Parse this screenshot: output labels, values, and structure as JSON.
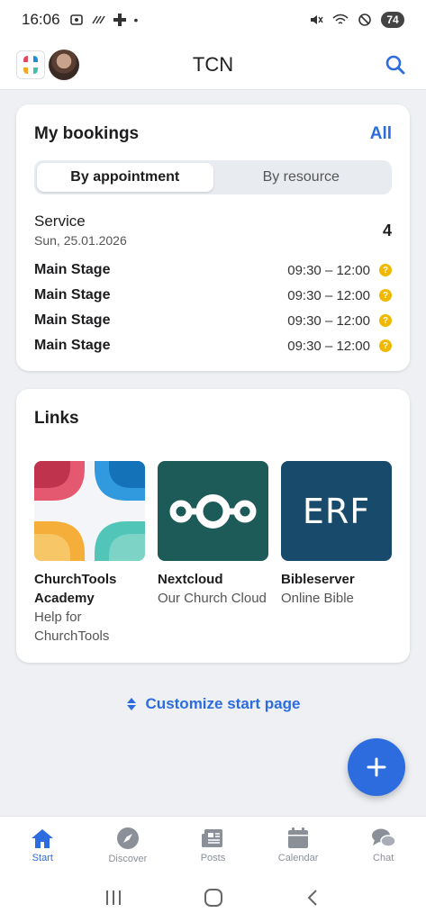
{
  "status_bar": {
    "time": "16:06",
    "battery": "74",
    "colors": {
      "icon": "#333333"
    }
  },
  "app_bar": {
    "title": "TCN",
    "icons": {
      "logo": "churchtools-logo-icon",
      "avatar": "user-avatar",
      "search": "search-icon"
    }
  },
  "bookings": {
    "title": "My bookings",
    "all_label": "All",
    "tabs": [
      {
        "label": "By appointment",
        "active": true
      },
      {
        "label": "By resource",
        "active": false
      }
    ],
    "service": {
      "name": "Service",
      "date": "Sun, 25.01.2026",
      "count": "4"
    },
    "rows": [
      {
        "resource": "Main Stage",
        "time": "09:30 – 12:00",
        "status_icon": "question-icon"
      },
      {
        "resource": "Main Stage",
        "time": "09:30 – 12:00",
        "status_icon": "question-icon"
      },
      {
        "resource": "Main Stage",
        "time": "09:30 – 12:00",
        "status_icon": "question-icon"
      },
      {
        "resource": "Main Stage",
        "time": "09:30 – 12:00",
        "status_icon": "question-icon"
      }
    ]
  },
  "links": {
    "title": "Links",
    "items": [
      {
        "name": "ChurchTools Academy",
        "subtitle": "Help for ChurchTools",
        "icon": "churchtools-academy-icon"
      },
      {
        "name": "Nextcloud",
        "subtitle": "Our Church Cloud",
        "icon": "nextcloud-icon"
      },
      {
        "name": "Bibleserver",
        "subtitle": "Online Bible",
        "icon": "erf-icon",
        "logo_text": "ERF"
      }
    ]
  },
  "customize_label": "Customize start page",
  "fab": {
    "icon": "plus-icon"
  },
  "bottom_nav": [
    {
      "label": "Start",
      "icon": "home-icon",
      "active": true
    },
    {
      "label": "Discover",
      "icon": "compass-icon",
      "active": false
    },
    {
      "label": "Posts",
      "icon": "newspaper-icon",
      "active": false
    },
    {
      "label": "Calendar",
      "icon": "calendar-icon",
      "active": false
    },
    {
      "label": "Chat",
      "icon": "chat-icon",
      "active": false
    }
  ],
  "colors": {
    "accent": "#2d6cdf",
    "pending": "#f1b800",
    "background": "#eef0f4",
    "nextcloud": "#1d5b58",
    "erf": "#184a6b"
  }
}
